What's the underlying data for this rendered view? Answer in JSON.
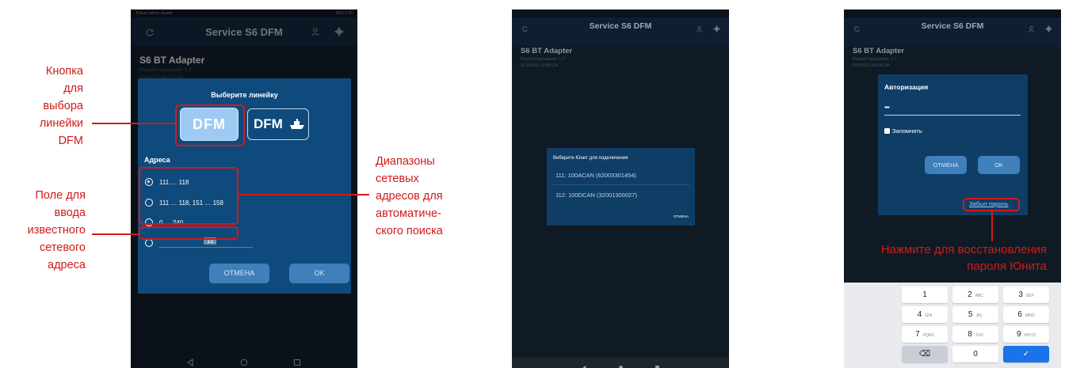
{
  "annotations": {
    "button_line": [
      "Кнопка",
      "для выбора",
      "линейки",
      "DFM"
    ],
    "address_field": [
      "Поле для",
      "ввода",
      "известного",
      "сетевого",
      "адреса"
    ],
    "ranges": [
      "Диапазоны",
      "сетевых",
      "адресов для",
      "автоматиче-",
      "ского поиска"
    ],
    "restore": [
      "Нажмите для восстановления",
      "пароля Юнита"
    ]
  },
  "screen1": {
    "status_left": "Только экстр. вызов",
    "status_right": "91% 9:20",
    "app_title": "Service S6 DFM",
    "device_name": "S6 BT Adapter",
    "firmware": "Версия прошивки: 1.7",
    "mac": "02:80:E1:69:D7:55",
    "dialog_title": "Выберите линейку",
    "btn_dfm": "DFM",
    "btn_dfm_ship": "DFM",
    "section": "Адреса",
    "options": [
      "111 … 118",
      "111 … 118, 151 … 158",
      "0 … 240"
    ],
    "manual_value": "11",
    "cancel": "ОТМЕНА",
    "ok": "OK"
  },
  "screen2": {
    "app_title": "Service S6 DFM",
    "device_name": "S6 BT Adapter",
    "firmware": "Версия прошивки: 1.7",
    "mac": "02:80:E1:16:0B:CA",
    "dialog_title": "Виберите Юнит для подключения",
    "units": [
      "111: 100ACAN (62003301454)",
      "112: 100DCAN (32001300027)"
    ],
    "cancel": "ОТМЕНА"
  },
  "screen3": {
    "app_title": "Service S6 DFM",
    "device_name": "S6 BT Adapter",
    "firmware": "Версия прошивки: 1.7",
    "mac": "02:80:E1:5A:3B:3A",
    "dialog_title": "Авторизация",
    "password": "••••",
    "remember": "Запомнить",
    "cancel": "ОТМЕНА",
    "ok": "OK",
    "forgot": "Забыл пароль",
    "keys": [
      {
        "d": "1",
        "l": ""
      },
      {
        "d": "2",
        "l": "ABC"
      },
      {
        "d": "3",
        "l": "DEF"
      },
      {
        "d": "4",
        "l": "GHI"
      },
      {
        "d": "5",
        "l": "JKL"
      },
      {
        "d": "6",
        "l": "MNO"
      },
      {
        "d": "7",
        "l": "PQRS"
      },
      {
        "d": "8",
        "l": "TUV"
      },
      {
        "d": "9",
        "l": "WXYZ"
      },
      {
        "d": "⌫",
        "l": ""
      },
      {
        "d": "0",
        "l": ""
      },
      {
        "d": "✓",
        "l": ""
      }
    ]
  },
  "colors": {
    "accent": "#d11a1a",
    "dialog": "#0f4a7c",
    "button": "#3f7fba",
    "selected": "#9dcaf2"
  }
}
